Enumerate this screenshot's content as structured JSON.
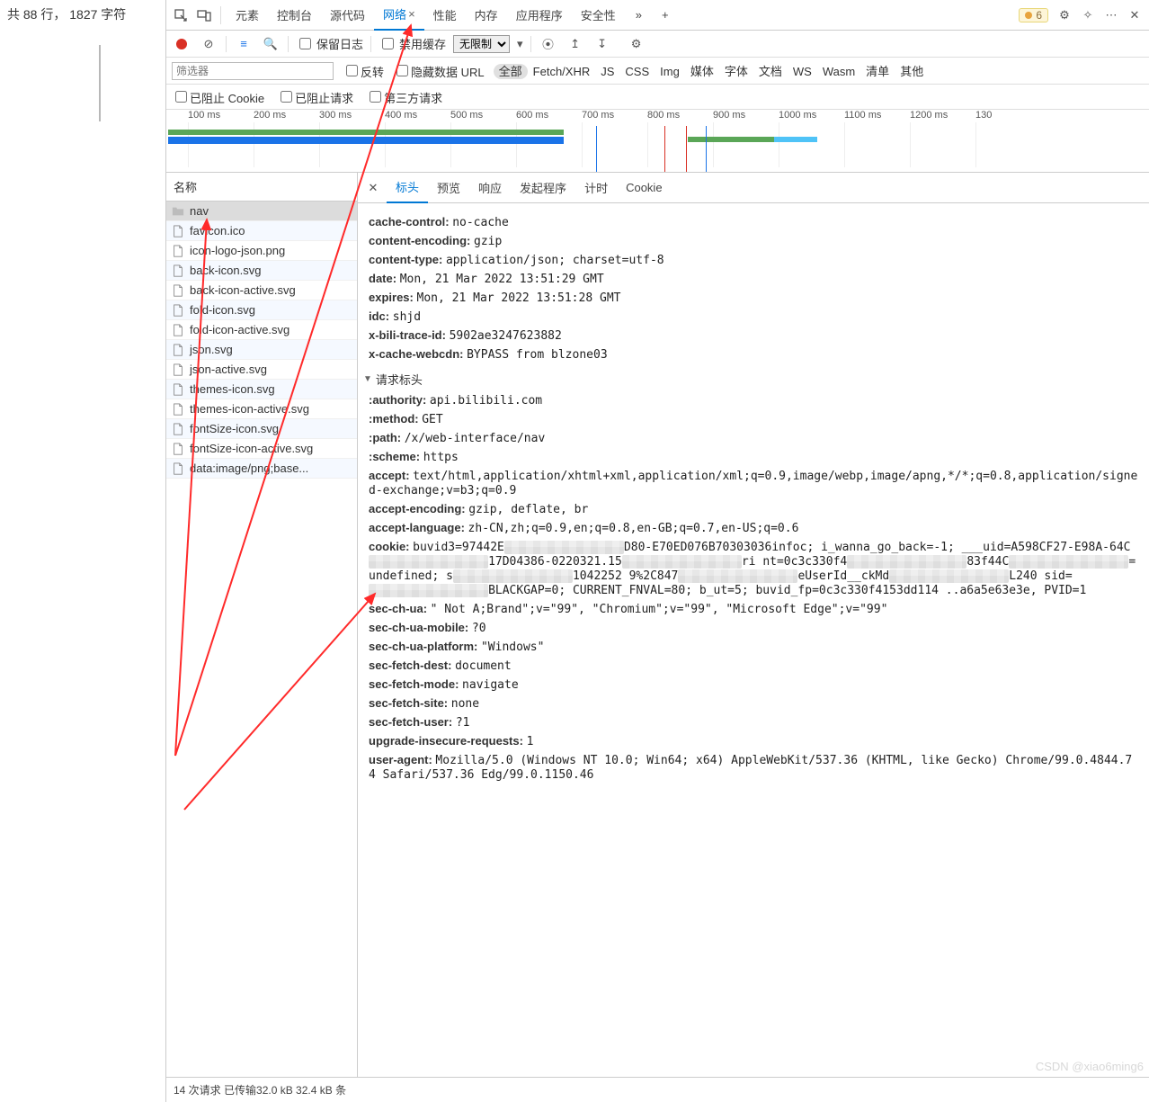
{
  "leftInfo": {
    "lines": "共 88 行，  1827 字符"
  },
  "devtools": {
    "issuesBadge": "6",
    "tabs": [
      "元素",
      "控制台",
      "源代码",
      "网络",
      "性能",
      "内存",
      "应用程序",
      "安全性"
    ],
    "activeTab": "网络",
    "more": "»",
    "plus": "+"
  },
  "toolbar": {
    "preserveLog": "保留日志",
    "disableCache": "禁用缓存",
    "throttle": "无限制"
  },
  "filter": {
    "placeholder": "筛选器",
    "invert": "反转",
    "hideDataUrl": "隐藏数据 URL",
    "types": [
      "全部",
      "Fetch/XHR",
      "JS",
      "CSS",
      "Img",
      "媒体",
      "字体",
      "文档",
      "WS",
      "Wasm",
      "清单",
      "其他"
    ],
    "activeType": "全部",
    "blockedCookies": "已阻止 Cookie",
    "blockedRequests": "已阻止请求",
    "thirdParty": "第三方请求"
  },
  "timeline": {
    "ticks": [
      "100 ms",
      "200 ms",
      "300 ms",
      "400 ms",
      "500 ms",
      "600 ms",
      "700 ms",
      "800 ms",
      "900 ms",
      "1000 ms",
      "1100 ms",
      "1200 ms",
      "130"
    ]
  },
  "requestList": {
    "header": "名称",
    "items": [
      {
        "name": "nav",
        "type": "folder"
      },
      {
        "name": "favicon.ico",
        "type": "file"
      },
      {
        "name": "icon-logo-json.png",
        "type": "file"
      },
      {
        "name": "back-icon.svg",
        "type": "file"
      },
      {
        "name": "back-icon-active.svg",
        "type": "file"
      },
      {
        "name": "fold-icon.svg",
        "type": "file"
      },
      {
        "name": "fold-icon-active.svg",
        "type": "file"
      },
      {
        "name": "json.svg",
        "type": "file"
      },
      {
        "name": "json-active.svg",
        "type": "file"
      },
      {
        "name": "themes-icon.svg",
        "type": "file"
      },
      {
        "name": "themes-icon-active.svg",
        "type": "file"
      },
      {
        "name": "fontSize-icon.svg",
        "type": "file"
      },
      {
        "name": "fontSize-icon-active.svg",
        "type": "file"
      },
      {
        "name": "data:image/png;base...",
        "type": "file"
      }
    ]
  },
  "detailTabs": [
    "标头",
    "预览",
    "响应",
    "发起程序",
    "计时",
    "Cookie"
  ],
  "activeDetailTab": "标头",
  "responseHeaders": [
    {
      "k": "cache-control:",
      "v": "no-cache"
    },
    {
      "k": "content-encoding:",
      "v": "gzip"
    },
    {
      "k": "content-type:",
      "v": "application/json; charset=utf-8"
    },
    {
      "k": "date:",
      "v": "Mon, 21 Mar 2022 13:51:29 GMT"
    },
    {
      "k": "expires:",
      "v": "Mon, 21 Mar 2022 13:51:28 GMT"
    },
    {
      "k": "idc:",
      "v": "shjd"
    },
    {
      "k": "x-bili-trace-id:",
      "v": "5902ae3247623882"
    },
    {
      "k": "x-cache-webcdn:",
      "v": "BYPASS from blzone03"
    }
  ],
  "requestHeadersTitle": "请求标头",
  "requestHeaders": [
    {
      "k": ":authority:",
      "v": "api.bilibili.com"
    },
    {
      "k": ":method:",
      "v": "GET"
    },
    {
      "k": ":path:",
      "v": "/x/web-interface/nav"
    },
    {
      "k": ":scheme:",
      "v": "https"
    },
    {
      "k": "accept:",
      "v": "text/html,application/xhtml+xml,application/xml;q=0.9,image/webp,image/apng,*/*;q=0.8,application/signed-exchange;v=b3;q=0.9"
    },
    {
      "k": "accept-encoding:",
      "v": "gzip, deflate, br"
    },
    {
      "k": "accept-language:",
      "v": "zh-CN,zh;q=0.9,en;q=0.8,en-GB;q=0.7,en-US;q=0.6"
    },
    {
      "k": "cookie:",
      "v": "buvid3=97442E________D80-E70ED076B70303036infoc; i_wanna_go_back=-1; ___uid=A598CF27-E98A-64C________17D04386-0220321.15________ri nt=0c3c330f4________83f44C________=undefined; s________1042252 9%2C847________eUserId__ckMd________L240  sid=________BLACKGAP=0; CURRENT_FNVAL=80; b_ut=5; buvid_fp=0c3c330f4153dd114 ..a6a5e63e3e, PVID=1"
    },
    {
      "k": "sec-ch-ua:",
      "v": "\" Not A;Brand\";v=\"99\", \"Chromium\";v=\"99\", \"Microsoft Edge\";v=\"99\""
    },
    {
      "k": "sec-ch-ua-mobile:",
      "v": "?0"
    },
    {
      "k": "sec-ch-ua-platform:",
      "v": "\"Windows\""
    },
    {
      "k": "sec-fetch-dest:",
      "v": "document"
    },
    {
      "k": "sec-fetch-mode:",
      "v": "navigate"
    },
    {
      "k": "sec-fetch-site:",
      "v": "none"
    },
    {
      "k": "sec-fetch-user:",
      "v": "?1"
    },
    {
      "k": "upgrade-insecure-requests:",
      "v": "1"
    },
    {
      "k": "user-agent:",
      "v": "Mozilla/5.0 (Windows NT 10.0; Win64; x64) AppleWebKit/537.36 (KHTML, like Gecko) Chrome/99.0.4844.74 Safari/537.36 Edg/99.0.1150.46"
    }
  ],
  "status": {
    "text": "14 次请求  已传输32.0 kB  32.4 kB 条"
  },
  "watermark": "CSDN @xiao6ming6"
}
